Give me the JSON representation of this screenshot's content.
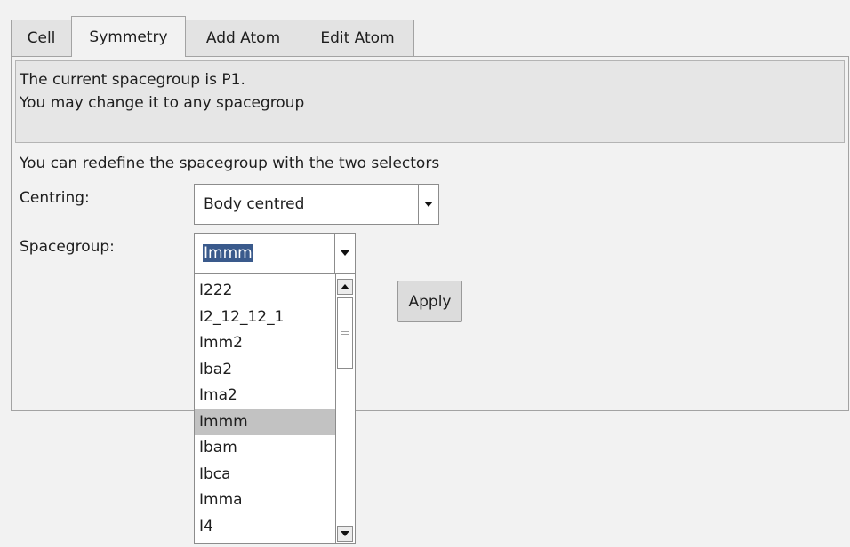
{
  "tabs": [
    {
      "label": "Cell",
      "active": false
    },
    {
      "label": "Symmetry",
      "active": true
    },
    {
      "label": "Add Atom",
      "active": false
    },
    {
      "label": "Edit Atom",
      "active": false
    }
  ],
  "info": {
    "line1": "The current spacegroup is P1.",
    "line2": "You may change it to any spacegroup"
  },
  "instruction": "You can redefine the spacegroup with the two selectors",
  "centring": {
    "label": "Centring:",
    "value": "Body centred"
  },
  "spacegroup": {
    "label": "Spacegroup:",
    "value": "Immm",
    "options": [
      "I222",
      "I2_12_12_1",
      "Imm2",
      "Iba2",
      "Ima2",
      "Immm",
      "Ibam",
      "Ibca",
      "Imma",
      "I4"
    ],
    "selected": "Immm"
  },
  "apply_label": "Apply",
  "icons": {
    "combo_arrow": "chevron-down-icon",
    "scroll_up": "arrow-up-icon",
    "scroll_down": "arrow-down-icon"
  }
}
